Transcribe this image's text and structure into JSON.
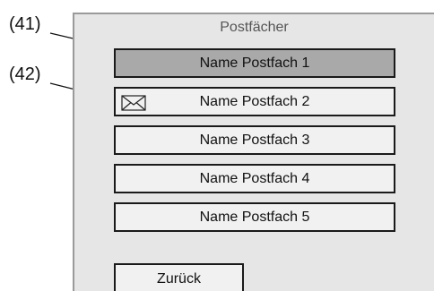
{
  "screen": {
    "title": "Postfächer",
    "mailboxes": [
      {
        "label": "Name Postfach 1",
        "selected": true,
        "icon": null
      },
      {
        "label": "Name Postfach 2",
        "selected": false,
        "icon": "envelope-icon"
      },
      {
        "label": "Name Postfach 3",
        "selected": false,
        "icon": null
      },
      {
        "label": "Name Postfach 4",
        "selected": false,
        "icon": null
      },
      {
        "label": "Name Postfach 5",
        "selected": false,
        "icon": null
      }
    ],
    "back_label": "Zurück"
  },
  "callouts": [
    {
      "label": "(41)"
    },
    {
      "label": "(42)"
    }
  ],
  "colors": {
    "screen_bg": "#e6e6e6",
    "selected_bg": "#a9a9a9",
    "button_bg": "#f1f1f1",
    "border": "#1a1a1a"
  }
}
